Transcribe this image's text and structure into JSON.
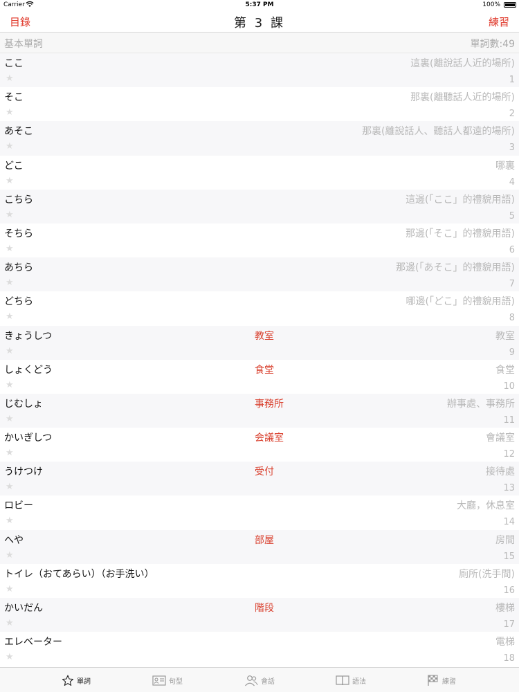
{
  "status_bar": {
    "carrier": "Carrier",
    "time": "5:37 PM",
    "battery": "100%"
  },
  "nav": {
    "back_label": "目錄",
    "title": "第 3 課",
    "practice_label": "練習"
  },
  "section": {
    "title": "基本單詞",
    "count": "單詞數:49"
  },
  "words": [
    {
      "kana": "ここ",
      "kanji": "",
      "meaning": "這裏(離說話人近的場所)",
      "num": "1"
    },
    {
      "kana": "そこ",
      "kanji": "",
      "meaning": "那裏(離聽話人近的場所)",
      "num": "2"
    },
    {
      "kana": "あそこ",
      "kanji": "",
      "meaning": "那裏(離說話人、聽話人都遠的場所)",
      "num": "3"
    },
    {
      "kana": "どこ",
      "kanji": "",
      "meaning": "哪裏",
      "num": "4"
    },
    {
      "kana": "こちら",
      "kanji": "",
      "meaning": "這邊(「ここ」的禮貌用語)",
      "num": "5"
    },
    {
      "kana": "そちら",
      "kanji": "",
      "meaning": "那邊(「そこ」的禮貌用語)",
      "num": "6"
    },
    {
      "kana": "あちら",
      "kanji": "",
      "meaning": "那邊(「あそこ」的禮貌用語)",
      "num": "7"
    },
    {
      "kana": "どちら",
      "kanji": "",
      "meaning": "哪邊(「どこ」的禮貌用語)",
      "num": "8"
    },
    {
      "kana": "きょうしつ",
      "kanji": "教室",
      "meaning": "教室",
      "num": "9"
    },
    {
      "kana": "しょくどう",
      "kanji": "食堂",
      "meaning": "食堂",
      "num": "10"
    },
    {
      "kana": "じむしょ",
      "kanji": "事務所",
      "meaning": "辦事處、事務所",
      "num": "11"
    },
    {
      "kana": "かいぎしつ",
      "kanji": "会議室",
      "meaning": "會議室",
      "num": "12"
    },
    {
      "kana": "うけつけ",
      "kanji": "受付",
      "meaning": "接待處",
      "num": "13"
    },
    {
      "kana": "ロビー",
      "kanji": "",
      "meaning": "大廳，休息室",
      "num": "14"
    },
    {
      "kana": "へや",
      "kanji": "部屋",
      "meaning": "房間",
      "num": "15"
    },
    {
      "kana": "トイレ（おてあらい）（お手洗い）",
      "kanji": "",
      "meaning": "廁所(洗手間)",
      "num": "16"
    },
    {
      "kana": "かいだん",
      "kanji": "階段",
      "meaning": "樓梯",
      "num": "17"
    },
    {
      "kana": "エレベーター",
      "kanji": "",
      "meaning": "電梯",
      "num": "18"
    }
  ],
  "tabs": [
    {
      "label": "單詞",
      "icon": "star-icon",
      "active": true
    },
    {
      "label": "句型",
      "icon": "id-card-icon",
      "active": false
    },
    {
      "label": "會話",
      "icon": "people-icon",
      "active": false
    },
    {
      "label": "語法",
      "icon": "book-icon",
      "active": false
    },
    {
      "label": "練習",
      "icon": "checkered-flag-icon",
      "active": false
    }
  ],
  "colors": {
    "accent": "#e0392b",
    "kanji": "#d9412f",
    "muted_text": "#b8b8b8",
    "alt_row": "#f7f7f9"
  }
}
